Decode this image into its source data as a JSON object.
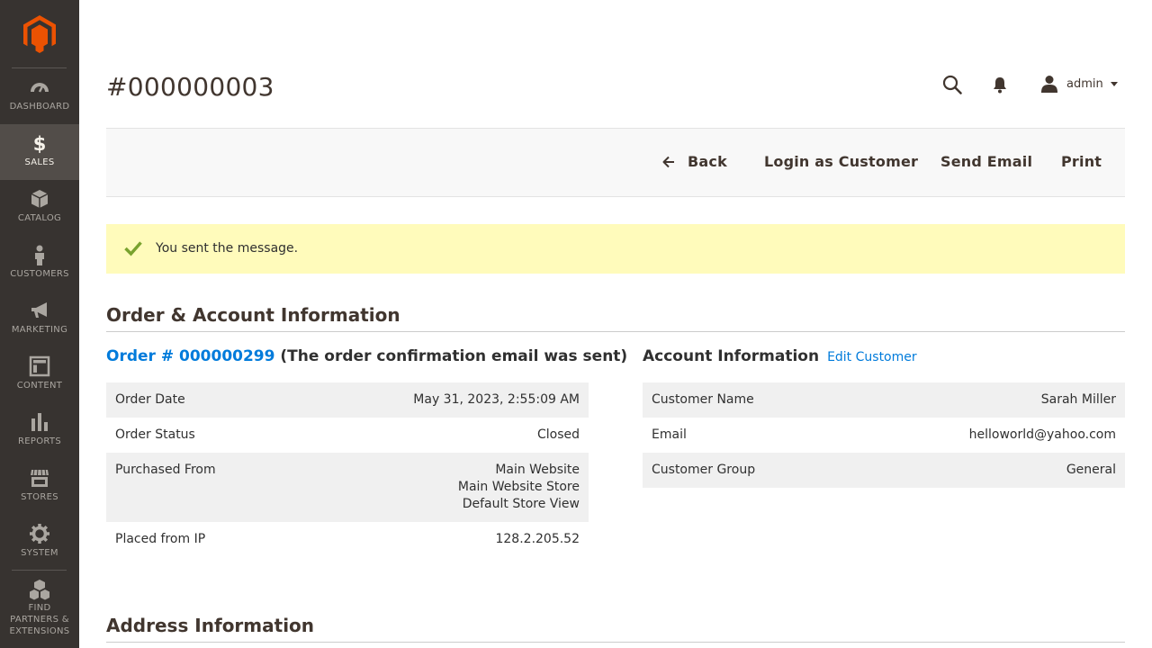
{
  "sidebar": {
    "items": [
      {
        "label": "Dashboard",
        "icon": "dashboard-icon"
      },
      {
        "label": "Sales",
        "icon": "dollar-icon",
        "active": true
      },
      {
        "label": "Catalog",
        "icon": "box-icon"
      },
      {
        "label": "Customers",
        "icon": "person-icon"
      },
      {
        "label": "Marketing",
        "icon": "megaphone-icon"
      },
      {
        "label": "Content",
        "icon": "layout-icon"
      },
      {
        "label": "Reports",
        "icon": "bar-chart-icon"
      },
      {
        "label": "Stores",
        "icon": "storefront-icon"
      },
      {
        "label": "System",
        "icon": "gear-icon"
      },
      {
        "label": "Find Partners & Extensions",
        "icon": "cubes-icon"
      }
    ]
  },
  "header": {
    "title": "#000000003",
    "user_name": "admin"
  },
  "actions": {
    "back": "Back",
    "login_as_customer": "Login as Customer",
    "send_email": "Send Email",
    "print": "Print"
  },
  "message": {
    "text": "You sent the message."
  },
  "order_account": {
    "section_title": "Order & Account Information",
    "order_link": "Order # 000000299",
    "order_note": "(The order confirmation email was sent)",
    "order_rows": [
      {
        "label": "Order Date",
        "value": "May 31, 2023, 2:55:09 AM"
      },
      {
        "label": "Order Status",
        "value": "Closed"
      },
      {
        "label": "Purchased From",
        "value_lines": [
          "Main Website",
          "Main Website Store",
          "Default Store View"
        ]
      },
      {
        "label": "Placed from IP",
        "value": "128.2.205.52"
      }
    ],
    "account_title": "Account Information",
    "edit_customer": "Edit Customer",
    "account_rows": [
      {
        "label": "Customer Name",
        "value": "Sarah Miller"
      },
      {
        "label": "Email",
        "value": "helloworld@yahoo.com"
      },
      {
        "label": "Customer Group",
        "value": "General"
      }
    ]
  },
  "address": {
    "section_title": "Address Information"
  },
  "colors": {
    "sidebar_bg": "#373330",
    "sidebar_active": "#524d49",
    "brand_orange": "#eb5202",
    "link_blue": "#007bdb",
    "message_bg": "#fffbbb",
    "success_green": "#79a22e"
  }
}
